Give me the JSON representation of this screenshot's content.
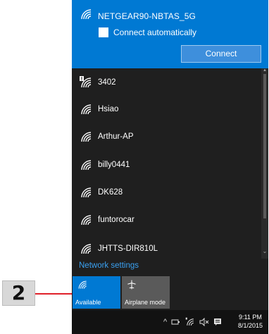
{
  "flyout": {
    "selected_network": {
      "name": "NETGEAR90-NBTAS_5G",
      "connect_automatically_label": "Connect automatically",
      "connect_automatically_checked": false,
      "connect_button": "Connect"
    },
    "networks": [
      {
        "name": "3402",
        "secured_warning": true
      },
      {
        "name": "Hsiao",
        "secured_warning": false
      },
      {
        "name": "Arthur-AP",
        "secured_warning": false
      },
      {
        "name": "billy0441",
        "secured_warning": false
      },
      {
        "name": "DK628",
        "secured_warning": false
      },
      {
        "name": "funtorocar",
        "secured_warning": false
      },
      {
        "name": "JHTTS-DIR810L",
        "secured_warning": false
      }
    ],
    "network_settings_link": "Network settings",
    "quick_actions": {
      "available_label": "Available",
      "airplane_label": "Airplane mode"
    }
  },
  "taskbar": {
    "time": "9:11 PM",
    "date": "8/1/2015",
    "tray_icons": [
      "chevron-up-icon",
      "power-plug-icon",
      "wifi-icon",
      "volume-mute-icon",
      "notification-icon"
    ]
  },
  "callout": {
    "number": "2"
  },
  "colors": {
    "accent": "#0079d3",
    "panel_bg": "#1f1f1f",
    "taskbar_bg": "#121212",
    "link": "#3aa0f0",
    "callout_line": "#e0202a"
  }
}
